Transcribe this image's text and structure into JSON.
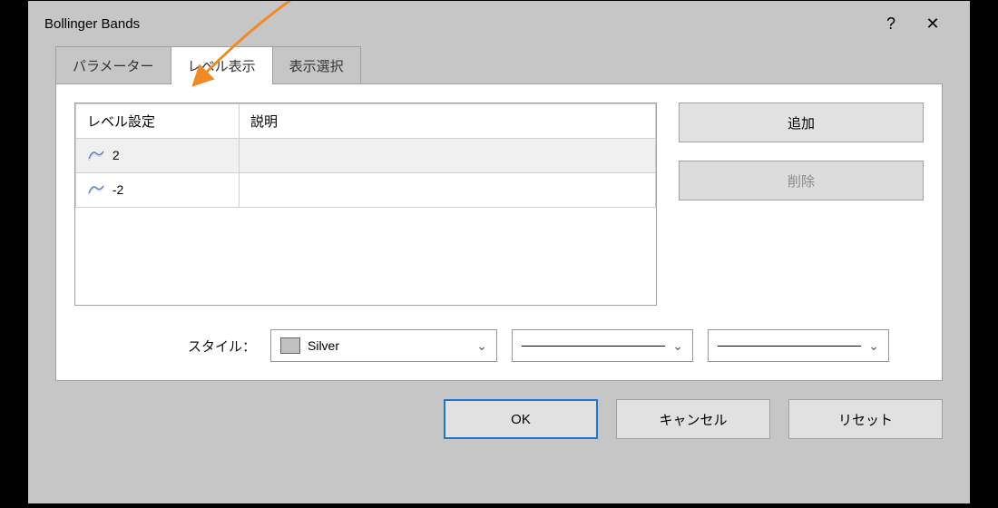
{
  "window": {
    "title": "Bollinger Bands",
    "help": "?",
    "close": "✕"
  },
  "tabs": {
    "parameters": "パラメーター",
    "levels": "レベル表示",
    "display": "表示選択"
  },
  "table": {
    "col_level": "レベル設定",
    "col_desc": "説明",
    "rows": [
      {
        "value": "2",
        "desc": ""
      },
      {
        "value": "-2",
        "desc": ""
      }
    ]
  },
  "buttons": {
    "add": "追加",
    "delete": "削除",
    "ok": "OK",
    "cancel": "キャンセル",
    "reset": "リセット"
  },
  "style": {
    "label": "スタイル：",
    "color_name": "Silver",
    "color_value": "#c0c0c0"
  }
}
